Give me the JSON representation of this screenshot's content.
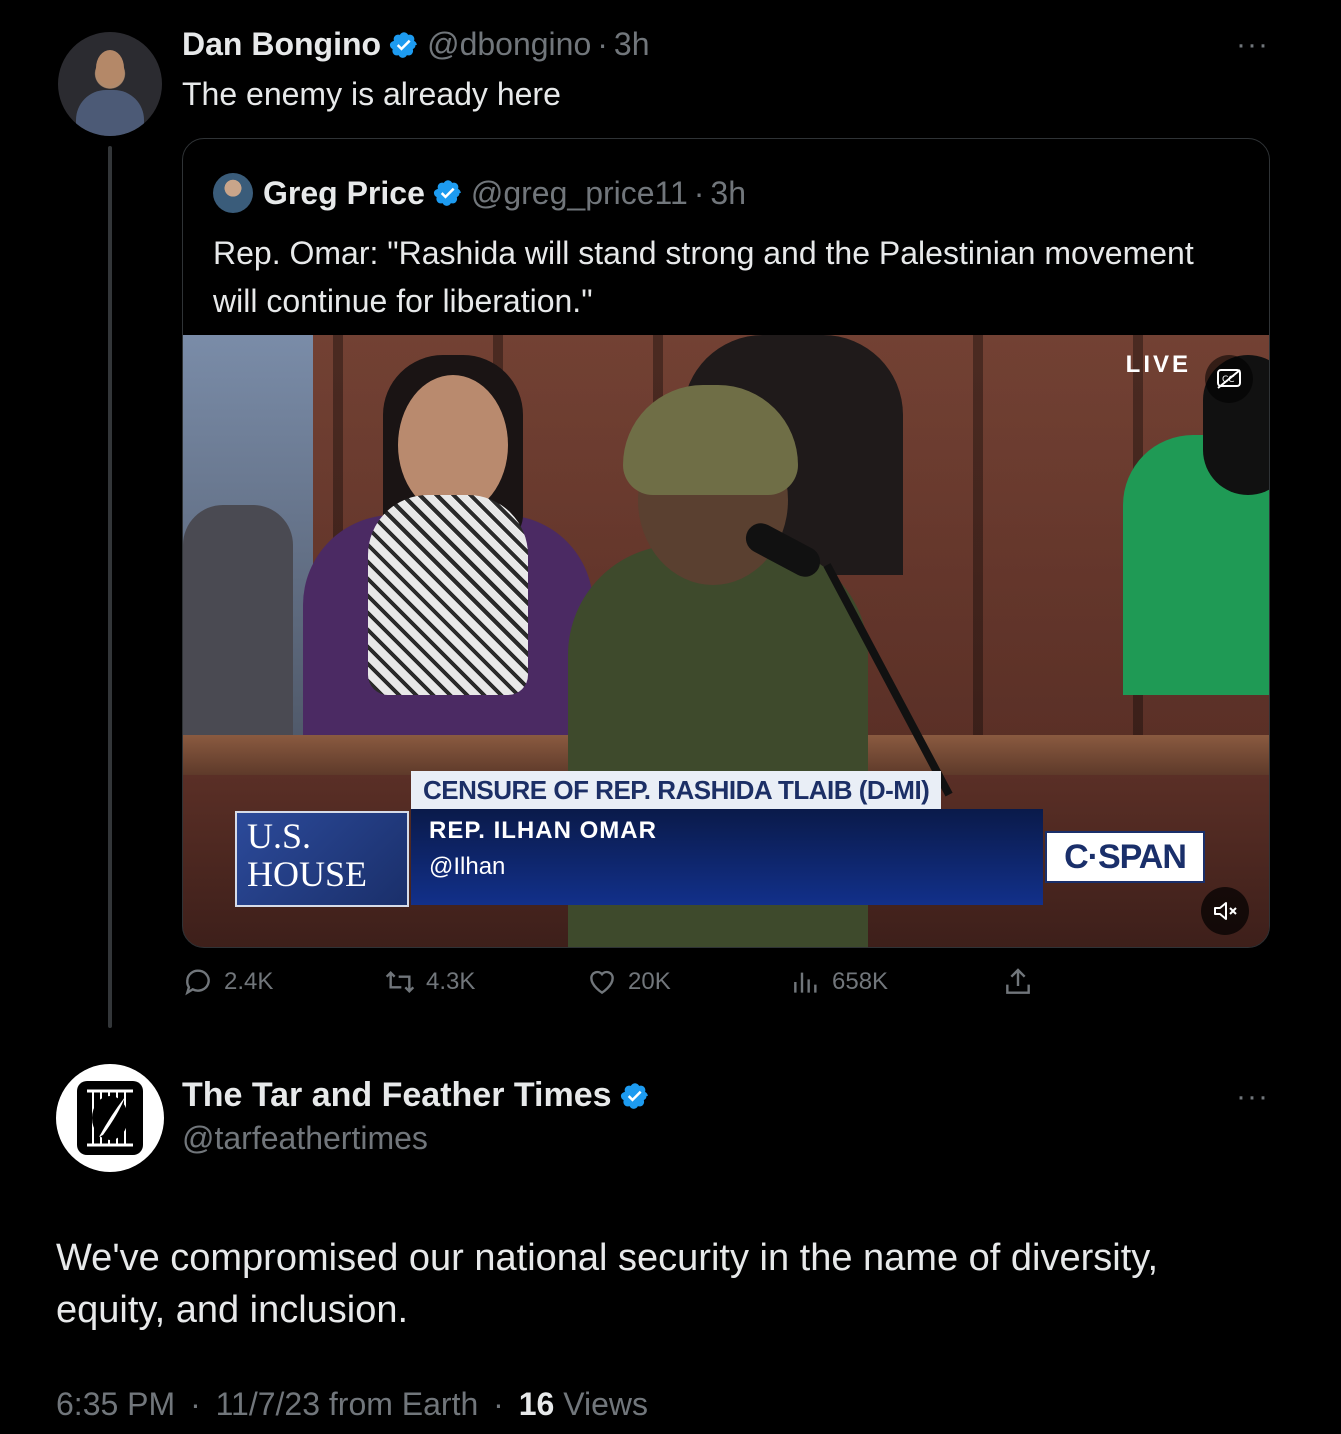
{
  "tweet1": {
    "author_name": "Dan Bongino",
    "handle": "@dbongino",
    "time": "3h",
    "text": "The enemy is already here",
    "more": "···"
  },
  "quote": {
    "author_name": "Greg Price",
    "handle": "@greg_price11",
    "time": "3h",
    "text": "Rep. Omar: \"Rashida will stand strong and the Palestinian movement will continue for liberation.\"",
    "video": {
      "live_label": "LIVE",
      "banner_title": "CENSURE OF REP. RASHIDA TLAIB (D-MI)",
      "house_line1": "U.S.",
      "house_line2": "HOUSE",
      "rep_name": "REP. ILHAN OMAR",
      "rep_handle": "@Ilhan",
      "network": "C·SPAN"
    }
  },
  "actions": {
    "replies": "2.4K",
    "reposts": "4.3K",
    "likes": "20K",
    "views": "658K"
  },
  "tweet2": {
    "author_name": "The Tar and Feather Times",
    "handle": "@tarfeathertimes",
    "text": "We've compromised our national security in the name of diversity, equity, and inclusion.",
    "more": "···",
    "meta_time": "6:35 PM",
    "meta_date": "11/7/23 from Earth",
    "views_count": "16",
    "views_label": "Views"
  },
  "colors": {
    "background": "#000000",
    "text": "#e7e9ea",
    "secondary": "#71767b",
    "verified": "#1d9bf0"
  }
}
